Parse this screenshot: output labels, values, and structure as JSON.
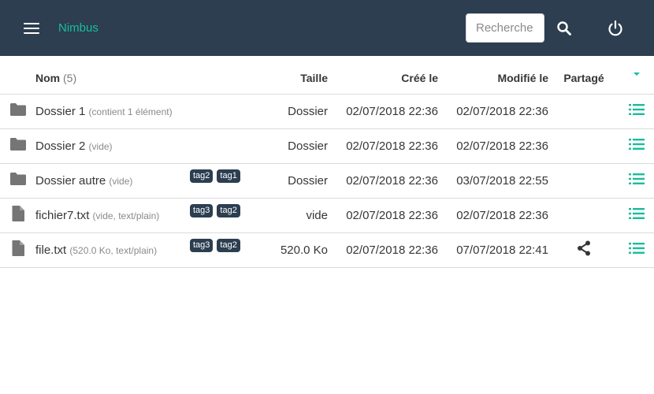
{
  "app": {
    "brand": "Nimbus"
  },
  "search": {
    "placeholder": "Recherche"
  },
  "colors": {
    "navbar": "#2c3e50",
    "accent": "#1abc9c",
    "tag": "#2c3e50",
    "text": "#363636",
    "muted": "#8a8a8a"
  },
  "icons": {
    "menu": "hamburger-icon",
    "search": "search-icon",
    "power": "power-icon",
    "folder": "folder-icon",
    "file": "file-icon",
    "share": "share-icon",
    "actions": "list-icon",
    "sort": "sort-caret-icon"
  },
  "table": {
    "headers": {
      "name": "Nom",
      "count": "(5)",
      "size": "Taille",
      "created": "Créé le",
      "modified": "Modifié le",
      "shared": "Partagé"
    },
    "rows": [
      {
        "type": "folder",
        "name": "Dossier 1",
        "detail": "(contient 1 élément)",
        "tags": [],
        "size": "Dossier",
        "created": "02/07/2018 22:36",
        "modified": "02/07/2018 22:36",
        "shared": false
      },
      {
        "type": "folder",
        "name": "Dossier 2",
        "detail": "(vide)",
        "tags": [],
        "size": "Dossier",
        "created": "02/07/2018 22:36",
        "modified": "02/07/2018 22:36",
        "shared": false
      },
      {
        "type": "folder",
        "name": "Dossier autre",
        "detail": "(vide)",
        "tags": [
          "tag2",
          "tag1"
        ],
        "size": "Dossier",
        "created": "02/07/2018 22:36",
        "modified": "03/07/2018 22:55",
        "shared": false
      },
      {
        "type": "file",
        "name": "fichier7.txt",
        "detail": "(vide, text/plain)",
        "tags": [
          "tag3",
          "tag2"
        ],
        "size": "vide",
        "created": "02/07/2018 22:36",
        "modified": "02/07/2018 22:36",
        "shared": false
      },
      {
        "type": "file",
        "name": "file.txt",
        "detail": "(520.0 Ko, text/plain)",
        "tags": [
          "tag3",
          "tag2"
        ],
        "size": "520.0 Ko",
        "created": "02/07/2018 22:36",
        "modified": "07/07/2018 22:41",
        "shared": true
      }
    ]
  }
}
